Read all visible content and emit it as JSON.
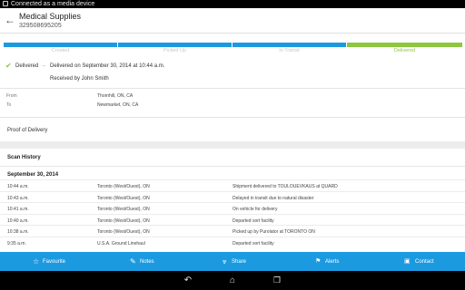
{
  "status_bar": {
    "usb_icon": "usb-icon",
    "message": "Connected as a media device"
  },
  "header": {
    "back_icon": "back-arrow-icon",
    "title": "Medical Supplies",
    "tracking_number": "329508695205"
  },
  "progress": {
    "steps": [
      {
        "label": "Created",
        "state": "passed"
      },
      {
        "label": "Picked Up",
        "state": "passed"
      },
      {
        "label": "In Transit",
        "state": "passed"
      },
      {
        "label": "Delivered",
        "state": "current"
      }
    ],
    "colors": {
      "passed": "#1b9ae0",
      "current": "#8dc63f"
    }
  },
  "status": {
    "icon": "check-icon",
    "label": "Delivered",
    "arrow_icon": "arrow-right-icon",
    "detail": "Delivered on September 30, 2014 at 10:44 a.m.",
    "received_by": "Received by John Smith"
  },
  "route": {
    "from_label": "From",
    "from_value": "Thornhill, ON, CA",
    "to_label": "To",
    "to_value": "Newmarket, ON, CA"
  },
  "proof_of_delivery": {
    "label": "Proof of Delivery"
  },
  "scan_history": {
    "title": "Scan History",
    "date": "September 30, 2014",
    "rows": [
      {
        "time": "10:44 a.m.",
        "location": "Toronto (West/Ouest), ON",
        "activity": "Shipment delivered to TOULOUEVKAUS at QUARD"
      },
      {
        "time": "10:43 a.m.",
        "location": "Toronto (West/Ouest), ON",
        "activity": "Delayed in transit due to natural disaster"
      },
      {
        "time": "10:41 a.m.",
        "location": "Toronto (West/Ouest), ON",
        "activity": "On vehicle for delivery"
      },
      {
        "time": "10:40 a.m.",
        "location": "Toronto (West/Ouest), ON",
        "activity": "Departed sort facility"
      },
      {
        "time": "10:38 a.m.",
        "location": "Toronto (West/Ouest), ON",
        "activity": "Picked up by Purolator at  TORONTO ON"
      },
      {
        "time": "9:35 a.m.",
        "location": "U.S.A. Ground Linehaul",
        "activity": "Departed sort facility"
      }
    ]
  },
  "bottom_bar": {
    "color": "#1b9ae0",
    "items": [
      {
        "label": "Favourite",
        "icon": "star-icon"
      },
      {
        "label": "Notes",
        "icon": "pencil-icon"
      },
      {
        "label": "Share",
        "icon": "share-icon"
      },
      {
        "label": "Alerts",
        "icon": "bell-icon"
      },
      {
        "label": "Contact",
        "icon": "chat-icon"
      }
    ]
  },
  "nav_bar": {
    "back_icon": "nav-back-icon",
    "home_icon": "nav-home-icon",
    "recents_icon": "nav-recents-icon"
  }
}
